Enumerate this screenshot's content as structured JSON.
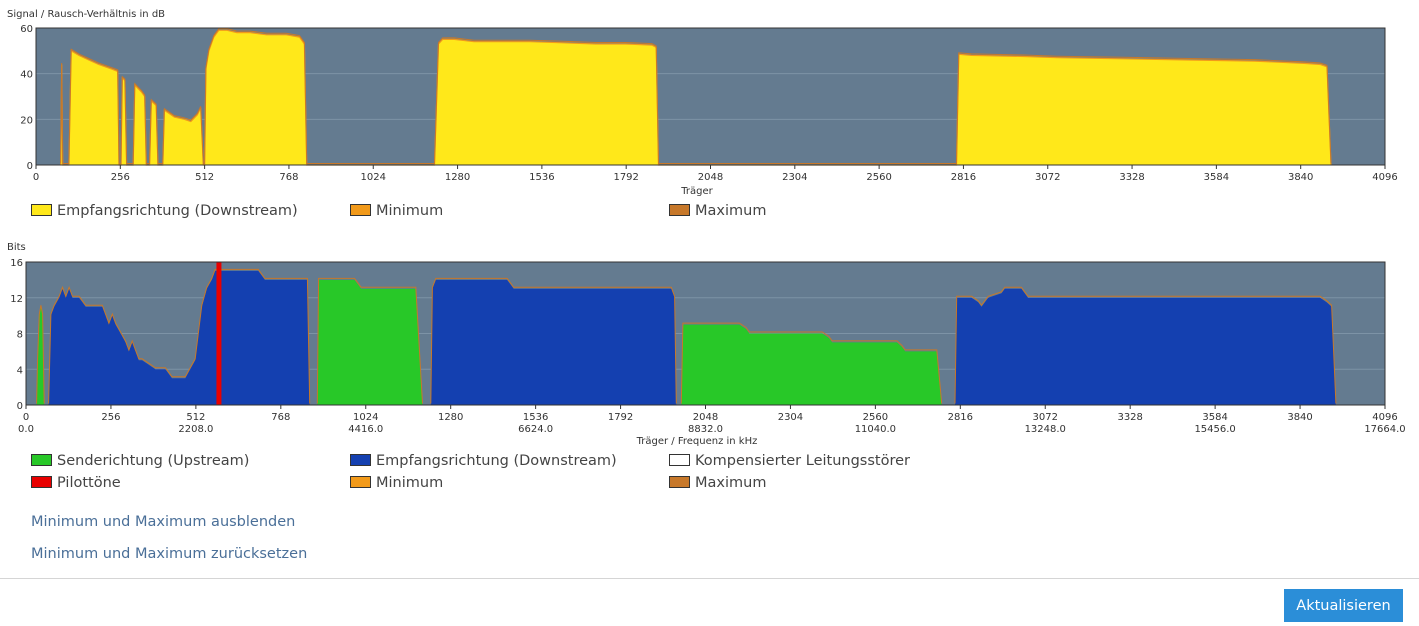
{
  "colors": {
    "plot_bg": "#647b90",
    "snr_fill": "#ffe81a",
    "minimum": "#f29a1a",
    "maximum": "#c7782a",
    "upstream": "#28c828",
    "downstream": "#1440b0",
    "pilot": "#e80000"
  },
  "snr_legend": [
    {
      "label": "Empfangsrichtung (Downstream)",
      "color": "#ffe81a"
    },
    {
      "label": "Minimum",
      "color": "#f29a1a"
    },
    {
      "label": "Maximum",
      "color": "#c7782a"
    }
  ],
  "bits_legend": [
    {
      "label": "Senderichtung (Upstream)",
      "color": "#28c828"
    },
    {
      "label": "Empfangsrichtung (Downstream)",
      "color": "#1440b0"
    },
    {
      "label": "Kompensierter Leitungsstörer",
      "color": "#ffffff"
    },
    {
      "label": "Pilottöne",
      "color": "#e80000"
    },
    {
      "label": "Minimum",
      "color": "#f29a1a"
    },
    {
      "label": "Maximum",
      "color": "#c7782a"
    }
  ],
  "links": {
    "toggle_minmax": "Minimum und Maximum ausblenden",
    "reset_minmax": "Minimum und Maximum zurücksetzen"
  },
  "buttons": {
    "refresh": "Aktualisieren"
  },
  "chart_data": [
    {
      "type": "area",
      "ylabel": "Signal / Rausch-Verhältnis in dB",
      "xlabel": "Träger",
      "xlim": [
        0,
        4096
      ],
      "ylim": [
        0,
        60
      ],
      "x_ticks": [
        0,
        256,
        512,
        768,
        1024,
        1280,
        1536,
        1792,
        2048,
        2304,
        2560,
        2816,
        3072,
        3328,
        3584,
        3840,
        4096
      ],
      "y_ticks": [
        0,
        20,
        40,
        60
      ],
      "grid": true,
      "legend_position": "bottom",
      "series": [
        {
          "name": "Empfangsrichtung (Downstream)",
          "points": [
            [
              75,
              0
            ],
            [
              78,
              44
            ],
            [
              81,
              0
            ],
            [
              100,
              0
            ],
            [
              107,
              50
            ],
            [
              130,
              48
            ],
            [
              160,
              46
            ],
            [
              190,
              44
            ],
            [
              230,
              42
            ],
            [
              248,
              41
            ],
            [
              252,
              0
            ],
            [
              258,
              0
            ],
            [
              262,
              38
            ],
            [
              270,
              37
            ],
            [
              275,
              0
            ],
            [
              295,
              0
            ],
            [
              300,
              35
            ],
            [
              320,
              32
            ],
            [
              330,
              30
            ],
            [
              335,
              0
            ],
            [
              345,
              0
            ],
            [
              350,
              28
            ],
            [
              365,
              26
            ],
            [
              370,
              0
            ],
            [
              385,
              0
            ],
            [
              390,
              24
            ],
            [
              410,
              22
            ],
            [
              420,
              21
            ],
            [
              450,
              20
            ],
            [
              470,
              19
            ],
            [
              490,
              22
            ],
            [
              500,
              25
            ],
            [
              508,
              0
            ],
            [
              512,
              0
            ],
            [
              516,
              42
            ],
            [
              525,
              50
            ],
            [
              540,
              56
            ],
            [
              555,
              59
            ],
            [
              580,
              59
            ],
            [
              610,
              58
            ],
            [
              650,
              58
            ],
            [
              700,
              57
            ],
            [
              760,
              57
            ],
            [
              800,
              56
            ],
            [
              815,
              53
            ],
            [
              822,
              0
            ],
            [
              1210,
              0
            ],
            [
              1222,
              53
            ],
            [
              1235,
              55
            ],
            [
              1270,
              55
            ],
            [
              1330,
              54
            ],
            [
              1500,
              54
            ],
            [
              1600,
              53.5
            ],
            [
              1700,
              53
            ],
            [
              1790,
              53
            ],
            [
              1870,
              52.5
            ],
            [
              1883,
              51.5
            ],
            [
              1890,
              0
            ],
            [
              2795,
              0
            ],
            [
              2802,
              48.5
            ],
            [
              2840,
              48
            ],
            [
              3000,
              47.5
            ],
            [
              3100,
              47
            ],
            [
              3300,
              46.5
            ],
            [
              3500,
              46
            ],
            [
              3700,
              45.5
            ],
            [
              3850,
              44.5
            ],
            [
              3900,
              44
            ],
            [
              3920,
              43
            ],
            [
              3932,
              0
            ]
          ]
        }
      ]
    },
    {
      "type": "area",
      "ylabel": "Bits",
      "xlabel": "Träger / Frequenz in kHz",
      "xlim": [
        0,
        4096
      ],
      "ylim": [
        0,
        16
      ],
      "x_ticks": [
        0,
        256,
        512,
        768,
        1024,
        1280,
        1536,
        1792,
        2048,
        2304,
        2560,
        2816,
        3072,
        3328,
        3584,
        3840,
        4096
      ],
      "x_ticks_secondary": [
        "0.0",
        "2208.0",
        "4416.0",
        "6624.0",
        "8832.0",
        "11040.0",
        "13248.0",
        "15456.0",
        "17664.0"
      ],
      "y_ticks": [
        0,
        4,
        8,
        12,
        16
      ],
      "grid": true,
      "legend_position": "bottom",
      "series": [
        {
          "name": "Senderichtung (Upstream)",
          "color": "#28c828",
          "segments": [
            [
              [
                32,
                0
              ],
              [
                35,
                5
              ],
              [
                40,
                10
              ],
              [
                45,
                11
              ],
              [
                50,
                10
              ],
              [
                55,
                0
              ]
            ],
            [
              [
                878,
                0
              ],
              [
                882,
                14
              ],
              [
                895,
                14
              ],
              [
                950,
                14
              ],
              [
                990,
                14
              ],
              [
                1000,
                13.5
              ],
              [
                1010,
                13
              ],
              [
                1080,
                13
              ],
              [
                1120,
                13
              ],
              [
                1175,
                13
              ],
              [
                1195,
                0
              ]
            ],
            [
              [
                1975,
                0
              ],
              [
                1980,
                9
              ],
              [
                2000,
                9
              ],
              [
                2050,
                9
              ],
              [
                2150,
                9
              ],
              [
                2170,
                8.5
              ],
              [
                2180,
                8
              ],
              [
                2260,
                8
              ],
              [
                2400,
                8
              ],
              [
                2420,
                7.5
              ],
              [
                2430,
                7
              ],
              [
                2550,
                7
              ],
              [
                2600,
                7
              ],
              [
                2625,
                7
              ],
              [
                2640,
                6.5
              ],
              [
                2650,
                6
              ],
              [
                2745,
                6
              ],
              [
                2760,
                0
              ]
            ]
          ]
        },
        {
          "name": "Empfangsrichtung (Downstream)",
          "color": "#1440b0",
          "segments": [
            [
              [
                68,
                0
              ],
              [
                75,
                10
              ],
              [
                85,
                11
              ],
              [
                100,
                12
              ],
              [
                110,
                13
              ],
              [
                120,
                12
              ],
              [
                130,
                13
              ],
              [
                140,
                12
              ],
              [
                160,
                12
              ],
              [
                180,
                11
              ],
              [
                200,
                11
              ],
              [
                230,
                11
              ],
              [
                240,
                10
              ],
              [
                250,
                9
              ],
              [
                260,
                10
              ],
              [
                270,
                9
              ],
              [
                285,
                8
              ],
              [
                300,
                7
              ],
              [
                310,
                6
              ],
              [
                320,
                7
              ],
              [
                330,
                6
              ],
              [
                340,
                5
              ],
              [
                350,
                5
              ],
              [
                370,
                4.5
              ],
              [
                390,
                4
              ],
              [
                420,
                4
              ],
              [
                430,
                3.5
              ],
              [
                440,
                3
              ],
              [
                480,
                3
              ],
              [
                495,
                4
              ],
              [
                510,
                5
              ],
              [
                520,
                8
              ],
              [
                530,
                11
              ],
              [
                545,
                13
              ],
              [
                560,
                14
              ],
              [
                570,
                15
              ],
              [
                590,
                15
              ],
              [
                640,
                15
              ],
              [
                700,
                15
              ],
              [
                720,
                14
              ],
              [
                750,
                14
              ],
              [
                780,
                14
              ],
              [
                800,
                14
              ],
              [
                848,
                14
              ],
              [
                855,
                0
              ]
            ],
            [
              [
                1220,
                0
              ],
              [
                1225,
                13
              ],
              [
                1235,
                14
              ],
              [
                1300,
                14
              ],
              [
                1400,
                14
              ],
              [
                1450,
                14
              ],
              [
                1460,
                13.5
              ],
              [
                1470,
                13
              ],
              [
                1700,
                13
              ],
              [
                1800,
                13
              ],
              [
                1945,
                13
              ],
              [
                1955,
                12
              ],
              [
                1960,
                0
              ]
            ],
            [
              [
                2800,
                0
              ],
              [
                2805,
                12
              ],
              [
                2850,
                12
              ],
              [
                2870,
                11.5
              ],
              [
                2880,
                11
              ],
              [
                2900,
                12
              ],
              [
                2940,
                12.5
              ],
              [
                2950,
                13
              ],
              [
                2980,
                13
              ],
              [
                3000,
                13
              ],
              [
                3010,
                12.5
              ],
              [
                3020,
                12
              ],
              [
                3100,
                12
              ],
              [
                3300,
                12
              ],
              [
                3600,
                12
              ],
              [
                3800,
                12
              ],
              [
                3900,
                12
              ],
              [
                3920,
                11.5
              ],
              [
                3935,
                11
              ],
              [
                3948,
                0
              ]
            ]
          ]
        },
        {
          "name": "Pilottöne",
          "color": "#e80000",
          "x": 580
        }
      ]
    }
  ]
}
